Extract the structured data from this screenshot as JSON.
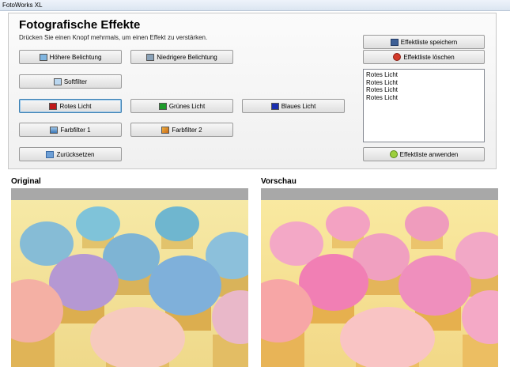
{
  "window": {
    "title": "FotoWorks XL"
  },
  "header": {
    "title": "Fotografische Effekte",
    "hint": "Drücken Sie einen Knopf mehrmals, um einen Effekt zu verstärken."
  },
  "buttons": {
    "hoehere_belichtung": "Höhere Belichtung",
    "niedrigere_belichtung": "Niedrigere Belichtung",
    "softfilter": "Softfilter",
    "rotes_licht": "Rotes Licht",
    "gruenes_licht": "Grünes Licht",
    "blaues_licht": "Blaues Licht",
    "farbfilter_1": "Farbfilter 1",
    "farbfilter_2": "Farbfilter 2",
    "zuruecksetzen": "Zurücksetzen",
    "effektliste_speichern": "Effektliste speichern",
    "effektliste_loeschen": "Effektliste löschen",
    "effektliste_anwenden": "Effektliste anwenden"
  },
  "effect_list": [
    "Rotes Licht",
    "Rotes Licht",
    "Rotes Licht",
    "Rotes Licht"
  ],
  "panes": {
    "original_label": "Original",
    "preview_label": "Vorschau"
  },
  "icons": {
    "hoehere_belichtung": "exposure-up-icon",
    "niedrigere_belichtung": "exposure-down-icon",
    "softfilter": "soft-filter-icon",
    "rotes_licht": "red-light-icon",
    "gruenes_licht": "green-light-icon",
    "blaues_licht": "blue-light-icon",
    "farbfilter_1": "color-filter-1-icon",
    "farbfilter_2": "color-filter-2-icon",
    "zuruecksetzen": "undo-icon",
    "effektliste_speichern": "save-disk-icon",
    "effektliste_loeschen": "delete-icon",
    "effektliste_anwenden": "apply-check-icon"
  },
  "colors": {
    "red_light": "#c01818",
    "green_light": "#1d9a2a",
    "blue_light": "#1a2fb0",
    "accent_focus": "#3c7fb1"
  }
}
